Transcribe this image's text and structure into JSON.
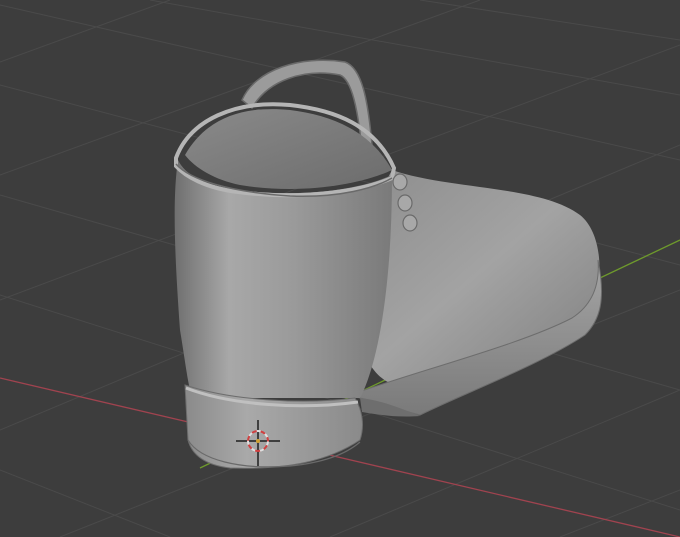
{
  "viewport": {
    "kind": "blender-3d-viewport",
    "shading": "solid",
    "background_color": "#3d3d3d",
    "grid_line_color": "#4a4a4a",
    "x_axis_color": "#a0434f",
    "y_axis_color": "#6e9a2c"
  },
  "object": {
    "type": "boot-mesh",
    "base_color": "#8f8f8f"
  },
  "cursor": {
    "icon": "3d-cursor-icon",
    "ring_primary": "#e0e0e0",
    "ring_secondary": "#d04040"
  }
}
